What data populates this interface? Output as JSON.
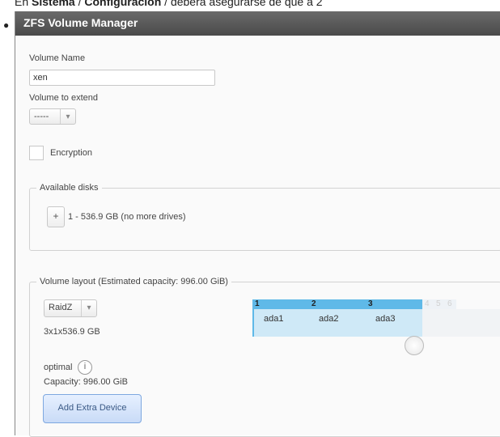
{
  "caption": {
    "prefix": "En ",
    "bold1": "Sistema",
    "sep": " / ",
    "bold2": "Configuración",
    "suffix": " / deberá asegurarse de que a 2"
  },
  "window": {
    "title": "ZFS Volume Manager"
  },
  "form": {
    "volume_name_label": "Volume Name",
    "volume_name_value": "xen",
    "extend_label": "Volume to extend",
    "extend_value": "-----",
    "encryption_label": "Encryption"
  },
  "available_disks": {
    "legend": "Available disks",
    "plus_label": "+",
    "summary": "1 - 536.9 GB (no more drives)"
  },
  "layout": {
    "legend": "Volume layout (Estimated capacity: 996.00 GiB)",
    "raid_value": "RaidZ",
    "size_text": "3x1x536.9 GB",
    "status": "optimal",
    "capacity": "Capacity: 996.00 GiB",
    "add_button": "Add Extra Device",
    "columns": [
      "1",
      "2",
      "3"
    ],
    "faded_columns": [
      "4",
      "5",
      "6"
    ],
    "disks": [
      "ada1",
      "ada2",
      "ada3"
    ]
  },
  "colors": {
    "grid_header": "#5fb9e8",
    "grid_cell": "#cfe9f7",
    "titlebar": "#555555"
  }
}
